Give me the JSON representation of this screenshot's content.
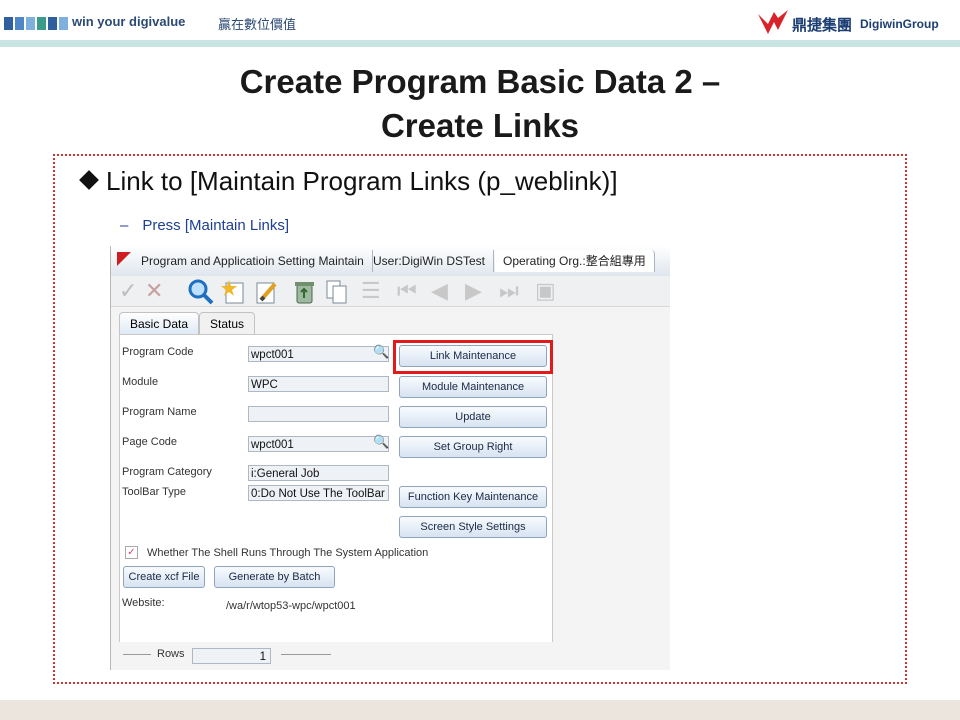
{
  "banner": {
    "slogan": "win your digivalue",
    "slogan_cn": "贏在數位價值",
    "brand_cn": "鼎捷集團",
    "brand_en": "DigiwinGroup",
    "square_colors": [
      "#2f5f9f",
      "#4f86c6",
      "#7fb0dd",
      "#3a9b8a",
      "#2f5f9f",
      "#7fb0dd"
    ]
  },
  "slide": {
    "title_line1": "Create Program Basic Data 2 –",
    "title_line2": "Create Links",
    "bullet": "Link to [Maintain Program Links (p_weblink)]",
    "sub_dash": "–",
    "sub_text": "Press [Maintain Links]"
  },
  "app": {
    "tabs": [
      "Program and Applicatioin Setting Maintain",
      "User:DigiWin DSTest",
      "Operating Org.:整合組專用"
    ],
    "toolbar_icons": [
      "confirm-check-icon",
      "cancel-x-icon",
      "query-magnifier-icon",
      "new-record-icon",
      "edit-pencil-icon",
      "delete-recycle-icon",
      "copy-icon",
      "separator-icon",
      "first-record-icon",
      "previous-record-icon",
      "next-record-icon",
      "last-record-icon",
      "export-icon"
    ],
    "panel_tabs": [
      "Basic Data",
      "Status"
    ],
    "fields": {
      "program_code_label": "Program Code",
      "program_code_value": "wpct001",
      "module_label": "Module",
      "module_value": "WPC",
      "program_name_label": "Program Name",
      "program_name_value": "",
      "page_code_label": "Page Code",
      "page_code_value": "wpct001",
      "program_category_label": "Program Category",
      "program_category_value": "i:General Job",
      "toolbar_type_label": "ToolBar Type",
      "toolbar_type_value": "0:Do Not Use The ToolBar"
    },
    "right_buttons": [
      "Link Maintenance",
      "Module Maintenance",
      "Update",
      "Set Group Right",
      "Function Key Maintenance",
      "Screen Style Settings"
    ],
    "shell_checkbox_label": "Whether The Shell Runs Through The System Application",
    "shell_checkbox_checked": true,
    "create_xcf_label": "Create xcf File",
    "generate_batch_label": "Generate by Batch",
    "website_label": "Website:",
    "website_value": "/wa/r/wtop53-wpc/wpct001",
    "rows_label": "Rows",
    "rows_value": "1"
  },
  "colors": {
    "highlight": "#e11b1b",
    "dashed_border": "#cc3333",
    "bullet_sub": "#1d3f95"
  }
}
